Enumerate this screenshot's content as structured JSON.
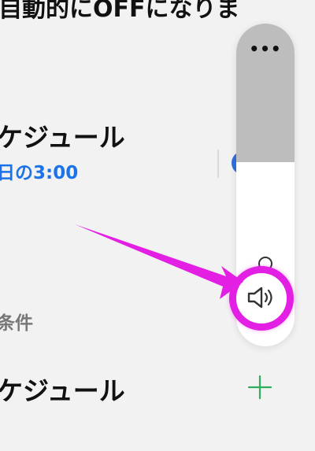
{
  "header": {
    "partial_text": "自動的にOFFになりま"
  },
  "schedule_item_1": {
    "title": "ケジュール",
    "time": "日の3:00"
  },
  "conditions_section": {
    "label": "条件"
  },
  "schedule_item_2": {
    "title": "ケジュール",
    "add_icon": "plus-icon"
  },
  "volume_control": {
    "more_icon": "more-dots-icon",
    "more_text": "•••",
    "speaker_icon": "speaker-volume-icon",
    "level": 0.43
  },
  "annotation": {
    "color": "#e41fe4"
  },
  "colors": {
    "accent_blue": "#1a73e8",
    "add_green": "#2eae5b",
    "background": "#f2f2f2"
  }
}
